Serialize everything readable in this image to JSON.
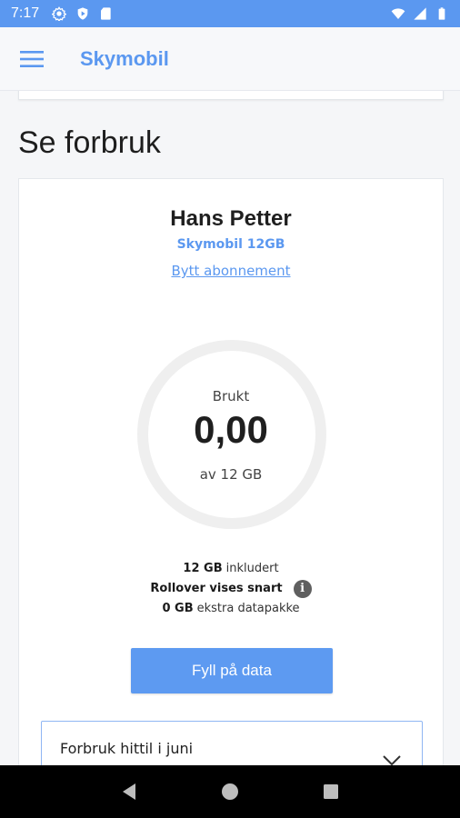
{
  "status_bar": {
    "time": "7:17",
    "left_icons": [
      "settings-icon",
      "shield-icon",
      "sd-card-icon"
    ],
    "right_icons": [
      "wifi-icon",
      "signal-icon",
      "battery-icon"
    ]
  },
  "app_bar": {
    "title": "Skymobil",
    "menu_icon": "hamburger-menu-icon",
    "accent_color": "#5b98f0"
  },
  "page": {
    "title": "Se forbruk"
  },
  "subscription": {
    "user_name": "Hans Petter",
    "plan_name": "Skymobil 12GB",
    "change_plan_link": "Bytt abonnement"
  },
  "gauge": {
    "label": "Brukt",
    "value": "0,00",
    "total": "av 12 GB",
    "used_fraction": 0.0
  },
  "info": {
    "included_bold": "12 GB",
    "included_rest": " inkludert",
    "rollover": "Rollover vises snart",
    "info_icon": "i",
    "extra_bold": "0 GB",
    "extra_rest": " ekstra datapakke"
  },
  "actions": {
    "fill_data": "Fyll på data"
  },
  "usage_dropdown": {
    "label": "Forbruk hittil i juni"
  },
  "nav_bar": {
    "buttons": [
      "back-icon",
      "home-icon",
      "recents-icon"
    ]
  }
}
